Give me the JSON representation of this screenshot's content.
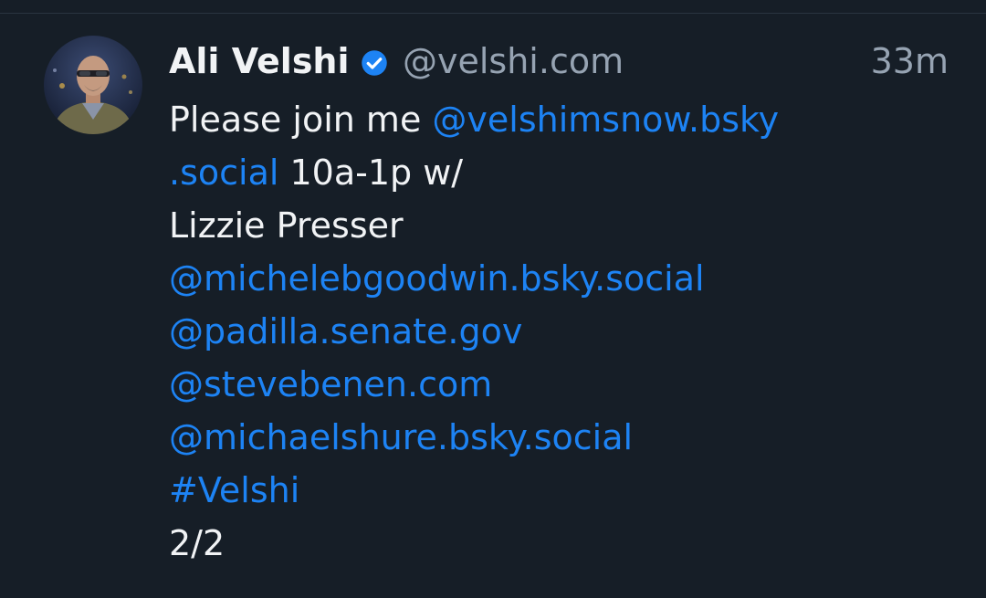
{
  "post": {
    "author": {
      "display_name": "Ali Velshi",
      "handle": "@velshi.com",
      "verified": true,
      "avatar": "user-avatar-photo"
    },
    "timestamp": "33m",
    "body": {
      "line1_text": "Please join me ",
      "line1_link": "@velshimsnow.bsky",
      "line2_link": ".social",
      "line2_text": " 10a-1p w/",
      "line3_text": "Lizzie Presser",
      "mention_goodwin": "@michelebgoodwin.bsky.social",
      "mention_padilla": "@padilla.senate.gov",
      "mention_benen": "@stevebenen.com",
      "mention_shure": "@michaelshure.bsky.social",
      "hashtag": "#Velshi",
      "thread_counter": "2/2"
    }
  },
  "colors": {
    "background": "#161e27",
    "text": "#f1f3f5",
    "muted": "#96a3b2",
    "link": "#1d83f4",
    "verified": "#1d83f4"
  },
  "icons": {
    "verified": "verified-check-icon"
  }
}
